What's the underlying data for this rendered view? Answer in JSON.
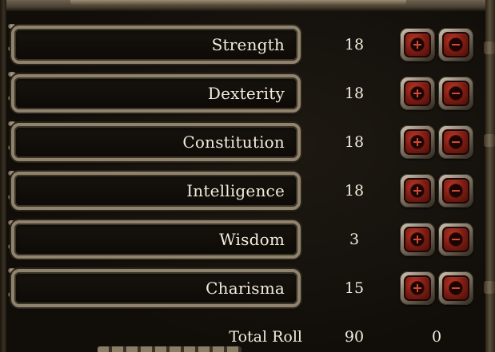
{
  "stats": [
    {
      "label": "Strength",
      "value": "18"
    },
    {
      "label": "Dexterity",
      "value": "18"
    },
    {
      "label": "Constitution",
      "value": "18"
    },
    {
      "label": "Intelligence",
      "value": "18"
    },
    {
      "label": "Wisdom",
      "value": "3"
    },
    {
      "label": "Charisma",
      "value": "15"
    }
  ],
  "totals": {
    "label": "Total Roll",
    "value": "90",
    "remaining": "0"
  },
  "icons": {
    "increase": "plus-icon",
    "decrease": "minus-icon"
  },
  "colors": {
    "text": "#f3ecdc",
    "button_red": "#7e1c12",
    "frame_stone": "#8f836d",
    "background": "#110e0a"
  }
}
